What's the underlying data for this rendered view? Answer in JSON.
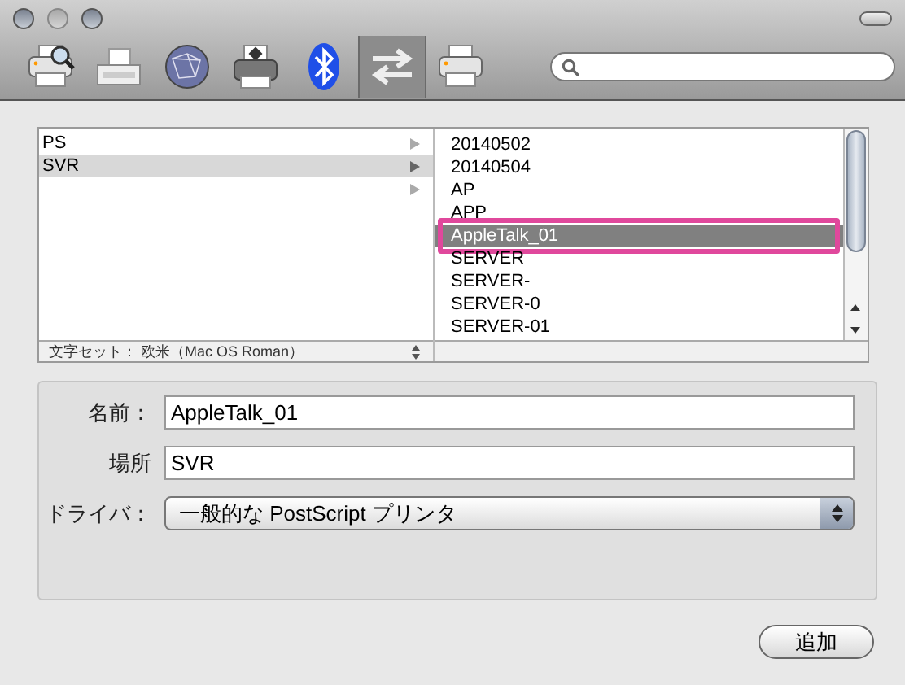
{
  "toolbar": {
    "items": [
      {
        "kind": "default",
        "selected": false
      },
      {
        "kind": "fax",
        "selected": false
      },
      {
        "kind": "ip",
        "selected": false
      },
      {
        "kind": "windows",
        "selected": false
      },
      {
        "kind": "bluetooth",
        "selected": false
      },
      {
        "kind": "appletalk",
        "selected": true
      },
      {
        "kind": "more",
        "selected": false
      }
    ]
  },
  "browser": {
    "left_items": [
      {
        "label": "PS",
        "selected": false
      },
      {
        "label": "SVR",
        "selected": true
      },
      {
        "selected": false
      }
    ],
    "right_items": [
      {
        "label": "20140502",
        "selected": false,
        "highlighted": false
      },
      {
        "label": "20140504",
        "selected": false,
        "highlighted": false
      },
      {
        "label": "AP",
        "selected": false,
        "highlighted": false
      },
      {
        "label": "APP",
        "selected": false,
        "highlighted": false
      },
      {
        "label": "AppleTalk_01",
        "selected": true,
        "highlighted": true
      },
      {
        "label": "SERVER",
        "selected": false,
        "highlighted": false
      },
      {
        "label": "SERVER-",
        "selected": false,
        "highlighted": false
      },
      {
        "label": "SERVER-0",
        "selected": false,
        "highlighted": false
      },
      {
        "label": "SERVER-01",
        "selected": false,
        "highlighted": false
      }
    ],
    "charset": "文字セット： 欧米（Mac OS Roman）"
  },
  "form": {
    "name": {
      "label": "名前：",
      "value": "AppleTalk_01"
    },
    "location": {
      "label": "場所",
      "value": "SVR"
    },
    "driver": {
      "label": "ドライバ：",
      "value": "一般的な PostScript プリンタ"
    }
  },
  "add_button": "追加"
}
